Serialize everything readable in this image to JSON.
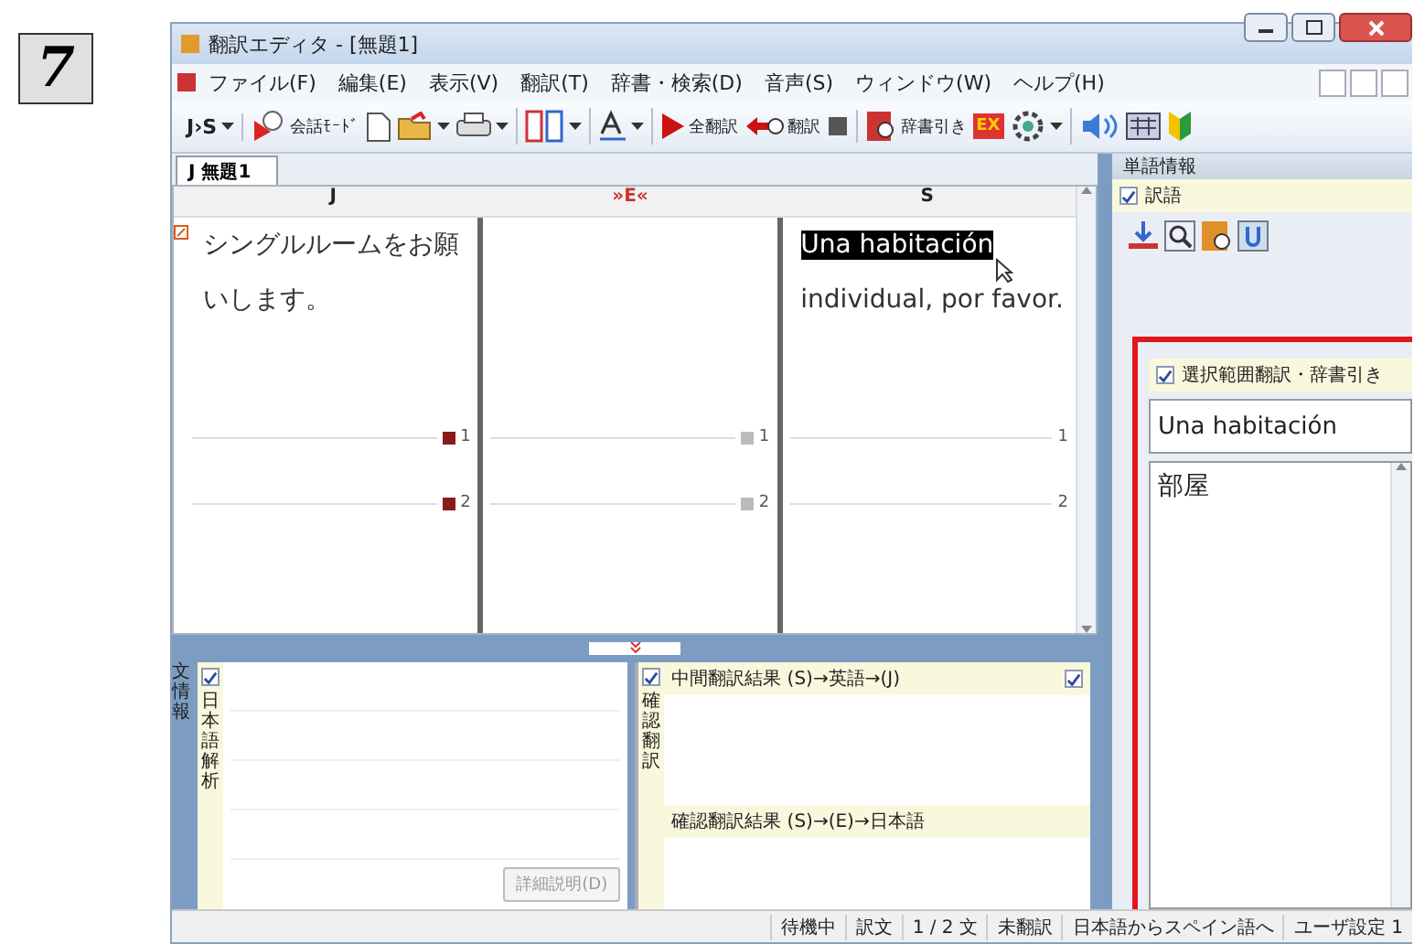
{
  "step": "7",
  "window": {
    "title": "翻訳エディタ - [無題1]"
  },
  "menu": [
    "ファイル(F)",
    "編集(E)",
    "表示(V)",
    "翻訳(T)",
    "辞書・検索(D)",
    "音声(S)",
    "ウィンドウ(W)",
    "ヘルプ(H)"
  ],
  "toolbar": [
    [
      {
        "kind": "text",
        "label": "J›S",
        "dropdown": true
      }
    ],
    [
      {
        "kind": "icon-text",
        "label": "会話ﾓｰﾄﾞ",
        "dropdown": false
      },
      {
        "kind": "icon",
        "dropdown": false
      },
      {
        "kind": "icon",
        "dropdown": true
      },
      {
        "kind": "icon",
        "dropdown": true
      }
    ],
    [
      {
        "kind": "icon",
        "dropdown": true
      }
    ],
    [
      {
        "kind": "icon",
        "dropdown": true
      }
    ],
    [
      {
        "kind": "icon-text",
        "label": "全翻訳",
        "dropdown": false
      },
      {
        "kind": "icon-text",
        "label": "翻訳",
        "dropdown": false
      },
      {
        "kind": "icon",
        "dropdown": false
      }
    ],
    [
      {
        "kind": "icon-text",
        "label": "辞書引き",
        "dropdown": false
      },
      {
        "kind": "badge",
        "label": "EX",
        "dropdown": false
      },
      {
        "kind": "icon",
        "dropdown": true
      }
    ],
    [
      {
        "kind": "icon",
        "dropdown": false
      },
      {
        "kind": "icon",
        "dropdown": false
      },
      {
        "kind": "icon",
        "dropdown": false
      }
    ]
  ],
  "tabs": [
    {
      "label": "J 無題1",
      "selected": true
    }
  ],
  "editor": {
    "columns": [
      {
        "header": "J",
        "markers": [
          {
            "label": "1",
            "kind": "flag"
          },
          {
            "label": "2",
            "kind": "flag"
          }
        ],
        "text": [
          {
            "text": "シングルルームをお願いします。",
            "selected": false
          }
        ]
      },
      {
        "header": "»E«",
        "markers": [
          {
            "label": "1",
            "kind": "box"
          },
          {
            "label": "2",
            "kind": "box"
          }
        ],
        "text": []
      },
      {
        "header": "S",
        "markers": [
          {
            "label": "1",
            "kind": "plain"
          },
          {
            "label": "2",
            "kind": "plain"
          }
        ],
        "text": [
          {
            "text": "Una habitación",
            "selected": true
          },
          {
            "text": " individual, por favor.",
            "selected": false
          }
        ]
      }
    ]
  },
  "sentence_info": {
    "title": "文情報",
    "checked": true,
    "label": "日本語解析",
    "button": {
      "label": "詳細説明(D)",
      "disabled": true
    }
  },
  "check_translation": {
    "title": "確認翻訳",
    "checked": true,
    "intermediate": "中間翻訳結果 (S)→英語→(J)",
    "intermediate_checked": true,
    "result": "確認翻訳結果 (S)→(E)→日本語"
  },
  "word_info": {
    "title": "単語情報",
    "option": {
      "label": "訳語",
      "checked": true
    },
    "selection": {
      "label": "選択範囲翻訳・辞書引き",
      "checked": true,
      "value": "Una habitación",
      "result": "部屋"
    }
  },
  "status_bar": [
    "待機中",
    "訳文",
    "1 / 2 文",
    "未翻訳",
    "日本語からスペイン語へ",
    "ユーザ設定 1"
  ]
}
